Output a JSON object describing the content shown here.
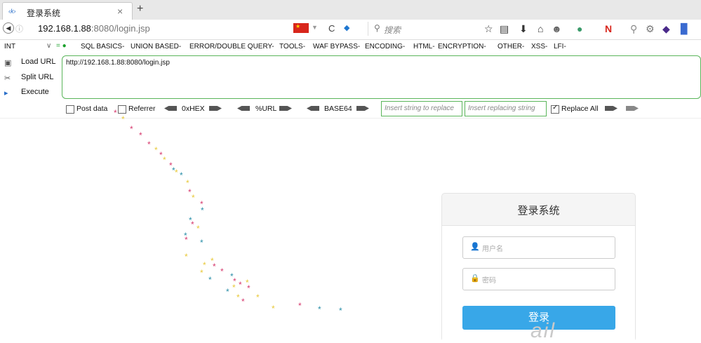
{
  "tab": {
    "title": "登录系统",
    "close": "×",
    "new_tab": "+",
    "favicon": "‹k›"
  },
  "nav": {
    "url_host": "192.168.1.88",
    "url_rest": ":8080/login.jsp",
    "search_placeholder": "搜索"
  },
  "hackbar": {
    "int_label": "INT",
    "menus": [
      "SQL BASICS-",
      "UNION BASED-",
      "ERROR/DOUBLE QUERY-",
      "TOOLS-",
      "WAF BYPASS-",
      "ENCODING-",
      "HTML-",
      "ENCRYPTION-",
      "OTHER-",
      "XSS-",
      "LFI-"
    ],
    "side": [
      {
        "label": "Load URL"
      },
      {
        "label": "Split URL"
      },
      {
        "label": "Execute"
      }
    ],
    "url_value": "http://192.168.1.88:8080/login.jsp",
    "options": {
      "post_data": "Post data",
      "referrer": "Referrer",
      "hex": "0xHEX",
      "url": "%URL",
      "base64": "BASE64",
      "insert_string": "Insert string to replace",
      "insert_replacing": "Insert replacing string",
      "replace_all": "Replace All"
    }
  },
  "login": {
    "title": "登录系统",
    "username_placeholder": "用户名",
    "password_placeholder": "密码",
    "button": "登录"
  },
  "watermark": "ail",
  "colors": {
    "accent": "#38a7e8",
    "hackbar_green": "#5ab55a",
    "star_pink": "#d63a6e",
    "star_yellow": "#e8c93a",
    "star_teal": "#2a8fa8"
  }
}
